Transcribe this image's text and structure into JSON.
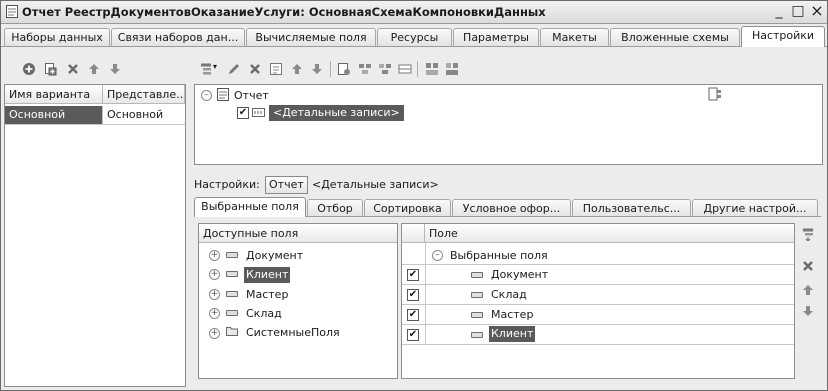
{
  "window": {
    "title": "Отчет РеестрДокументовОказаниеУслуги: ОсновнаяСхемаКомпоновкиДанных",
    "minimize": "_",
    "maximize": "□",
    "close": "×"
  },
  "top_tabs": [
    {
      "label": "Наборы данных"
    },
    {
      "label": "Связи наборов дан..."
    },
    {
      "label": "Вычисляемые поля"
    },
    {
      "label": "Ресурсы"
    },
    {
      "label": "Параметры"
    },
    {
      "label": "Макеты"
    },
    {
      "label": "Вложенные схемы"
    },
    {
      "label": "Настройки",
      "active": true
    }
  ],
  "variants": {
    "headers": [
      "Имя варианта",
      "Представле..."
    ],
    "rows": [
      [
        "Основной",
        "Основной"
      ]
    ]
  },
  "structure": {
    "root": "Отчет",
    "child": "<Детальные записи>"
  },
  "settings_bar": {
    "label": "Настройки:",
    "report_button": "Отчет",
    "detail": "<Детальные записи>"
  },
  "inner_tabs": [
    {
      "label": "Выбранные поля",
      "active": true
    },
    {
      "label": "Отбор"
    },
    {
      "label": "Сортировка"
    },
    {
      "label": "Условное офор..."
    },
    {
      "label": "Пользовательс..."
    },
    {
      "label": "Другие настрой..."
    }
  ],
  "available_fields": {
    "header": "Доступные поля",
    "items": [
      {
        "label": "Документ"
      },
      {
        "label": "Клиент",
        "selected": true
      },
      {
        "label": "Мастер"
      },
      {
        "label": "Склад"
      },
      {
        "label": "СистемныеПоля",
        "folder": true
      }
    ]
  },
  "selected_fields": {
    "header": "Поле",
    "group": "Выбранные поля",
    "items": [
      {
        "label": "Документ",
        "checked": true
      },
      {
        "label": "Склад",
        "checked": true
      },
      {
        "label": "Мастер",
        "checked": true
      },
      {
        "label": "Клиент",
        "checked": true,
        "selected": true
      }
    ]
  },
  "icons": {
    "toolbar_left": [
      "add-icon",
      "copy-icon",
      "delete-icon",
      "move-up-icon",
      "move-down-icon"
    ],
    "toolbar_right": [
      "add-group-icon",
      "edit-icon",
      "delete-icon",
      "properties-icon",
      "move-up-icon",
      "move-down-icon",
      "structure-icon",
      "structure-icon",
      "structure-icon",
      "structure-icon",
      "group-icon",
      "group-icon"
    ],
    "side": [
      "add-icon",
      "delete-icon",
      "move-up-icon",
      "move-down-icon"
    ]
  },
  "colors": {
    "selection": "#5a5a5a",
    "window_bg": "#ececec"
  }
}
